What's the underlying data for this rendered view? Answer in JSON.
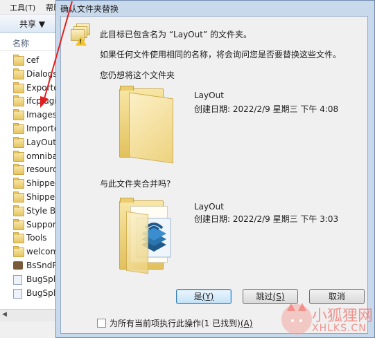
{
  "explorer": {
    "menu": [
      "工具(T)",
      "帮助"
    ],
    "share_label": "共享 ▼",
    "column_name": "名称",
    "files": [
      {
        "label": "cef",
        "type": "folder"
      },
      {
        "label": "Dialogs",
        "type": "folder"
      },
      {
        "label": "Exporte",
        "type": "folder"
      },
      {
        "label": "ifcplugi",
        "type": "folder"
      },
      {
        "label": "Images",
        "type": "folder"
      },
      {
        "label": "Importe",
        "type": "folder"
      },
      {
        "label": "LayOut",
        "type": "folder"
      },
      {
        "label": "omnibar",
        "type": "folder"
      },
      {
        "label": "resource",
        "type": "folder"
      },
      {
        "label": "Shipped",
        "type": "folder"
      },
      {
        "label": "Shipped",
        "type": "folder"
      },
      {
        "label": "Style Bu",
        "type": "folder"
      },
      {
        "label": "Support",
        "type": "folder"
      },
      {
        "label": "Tools",
        "type": "folder"
      },
      {
        "label": "welcom",
        "type": "folder"
      },
      {
        "label": "BsSndR",
        "type": "app"
      },
      {
        "label": "BugSpla",
        "type": "doc"
      },
      {
        "label": "BugSpla",
        "type": "doc"
      }
    ],
    "close_glyph": "✕"
  },
  "dialog": {
    "title": "确认文件夹替换",
    "message_line1": "此目标已包含名为 “LayOut” 的文件夹。",
    "message_line2": "如果任何文件使用相同的名称，将会询问您是否要替换这些文件。",
    "still_replace": "您仍想将这个文件夹",
    "existing": {
      "name": "LayOut",
      "date": "创建日期: 2022/2/9 星期三 下午 4:08"
    },
    "merge_question": "与此文件夹合并吗?",
    "incoming": {
      "name": "LayOut",
      "date": "创建日期: 2022/2/9 星期三 下午 3:03"
    },
    "buttons": {
      "yes": "是",
      "yes_key": "(Y)",
      "skip": "跳过",
      "skip_key": "(S)",
      "cancel": "取消"
    },
    "checkbox_label": "为所有当前项执行此操作(1 已找到)",
    "checkbox_key": "(A)"
  },
  "watermark": {
    "text": "小狐狸网",
    "url": "XHLKS.CN"
  },
  "colors": {
    "annotation_arrow": "#e02020",
    "dialog_frame": "#c9d9ec",
    "folder": "#e9cd70"
  }
}
